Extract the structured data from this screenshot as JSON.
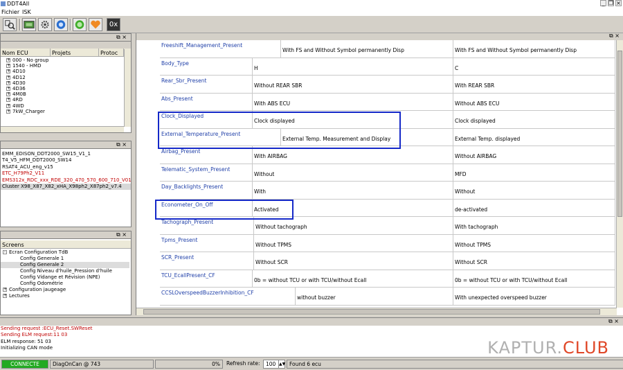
{
  "window": {
    "title": "DDT4All"
  },
  "menu": {
    "items": [
      "Fichier",
      "ISK"
    ]
  },
  "toolbar": {
    "zoom_label": "0x"
  },
  "ecu_panel": {
    "columns": [
      "Nom ECU",
      "Projets",
      "Protoc"
    ],
    "items": [
      "000 - No group",
      "1540 - HMD",
      "4D10",
      "4D12",
      "4D30",
      "4D36",
      "4M0B",
      "4RD",
      "4WD",
      "7kW_Charger"
    ]
  },
  "files_panel": {
    "items": [
      {
        "label": "EMM_EDISON_DDT2000_SW15_V1_1",
        "color": "#000000"
      },
      {
        "label": "T4_V5_HFM_DDT2000_SW14",
        "color": "#000000"
      },
      {
        "label": "RSAT4_ACU_eng_v15",
        "color": "#000000"
      },
      {
        "label": "ETC_H79Ph2_V11",
        "color": "#c00000"
      },
      {
        "label": "EMS312x_RDC_xxx_RDE_320_470_570_600_710_V01",
        "color": "#c00000"
      },
      {
        "label": "Cluster X98_X87_X82_xHA_X98ph2_X87ph2_v7.4",
        "color": "#000000"
      }
    ]
  },
  "screens_panel": {
    "header": "Screens",
    "tree": [
      {
        "label": "Ecran Configuration TdB",
        "level": 0,
        "sign": "-"
      },
      {
        "label": "Config Generale 1",
        "level": 1
      },
      {
        "label": "Config Generale 2",
        "level": 1,
        "selected": true
      },
      {
        "label": "Config Niveau d'huile_Pression d'huile",
        "level": 1
      },
      {
        "label": "Config Vidange et Révision (NPE)",
        "level": 1
      },
      {
        "label": "Config Odométrie",
        "level": 1
      },
      {
        "label": "Configuration jaugeage",
        "level": 0,
        "sign": "+"
      },
      {
        "label": "Lectures",
        "level": 0,
        "sign": "+"
      }
    ]
  },
  "grid": {
    "rows": [
      {
        "name": "Freeshift_Management_Present",
        "current": "With FS and Without Symbol permanently Disp",
        "reference": "With FS and Without Symbol permanently Disp",
        "split": 175
      },
      {
        "name": "Body_Type",
        "current": "H",
        "reference": "C",
        "split": 134
      },
      {
        "name": "Rear_Sbr_Present",
        "current": "Without REAR SBR",
        "reference": "With REAR SBR",
        "split": 134
      },
      {
        "name": "Abs_Present",
        "current": "With ABS ECU",
        "reference": "Without ABS ECU",
        "split": 134
      },
      {
        "name": "Clock_Displayed",
        "current": "Clock displayed",
        "reference": "Clock displayed",
        "split": 134
      },
      {
        "name": "External_Temperature_Present",
        "current": "External Temp. Measurement and Display",
        "reference": "External Temp. displayed",
        "split": 175
      },
      {
        "name": "Airbag_Present",
        "current": "With AIRBAG",
        "reference": "Without AIRBAG",
        "split": 134
      },
      {
        "name": "Telematic_System_Present",
        "current": "Without",
        "reference": "MFD",
        "split": 134
      },
      {
        "name": "Day_Backlights_Present",
        "current": "With",
        "reference": "Without",
        "split": 134
      },
      {
        "name": "Econometer_On_Off",
        "current": "Activated",
        "reference": "de-activated",
        "split": 134
      },
      {
        "name": "Tachograph_Present",
        "current": "Without tachograph",
        "reference": "With tachograph",
        "split": 136
      },
      {
        "name": "Tpms_Present",
        "current": "Without TPMS",
        "reference": "Without TPMS",
        "split": 136
      },
      {
        "name": "SCR_Present",
        "current": "Without SCR",
        "reference": "Without SCR",
        "split": 136
      },
      {
        "name": "TCU_EcallPresent_CF",
        "current": "0b = without TCU or with TCU/without Ecall",
        "reference": "0b = without TCU or with TCU/without Ecall",
        "split": 134
      },
      {
        "name": "CCSLOverspeedBuzzerInhibition_CF",
        "current": "without buzzer",
        "reference": "With unexpected overspeed buzzer",
        "split": 196
      }
    ]
  },
  "log": {
    "lines": [
      {
        "text": "Sending request :ECU_Reset.SWReset",
        "color": "#c00000"
      },
      {
        "text": "Sending ELM request:11 03",
        "color": "#c00000"
      },
      {
        "text": "ELM response: 51 03",
        "color": "#000000"
      },
      {
        "text": "Initializing CAN mode",
        "color": "#000000"
      }
    ]
  },
  "watermark": {
    "part1": "KAPTUR.",
    "part2": "CLUB"
  },
  "status": {
    "connection": "CONNECTE",
    "connection_color": "#22aa22",
    "adapter": "DiagOnCan @ 743",
    "progress": "0%",
    "refresh_label": "Refresh rate:",
    "refresh_value": "100",
    "found": "Found 6 ecu"
  }
}
